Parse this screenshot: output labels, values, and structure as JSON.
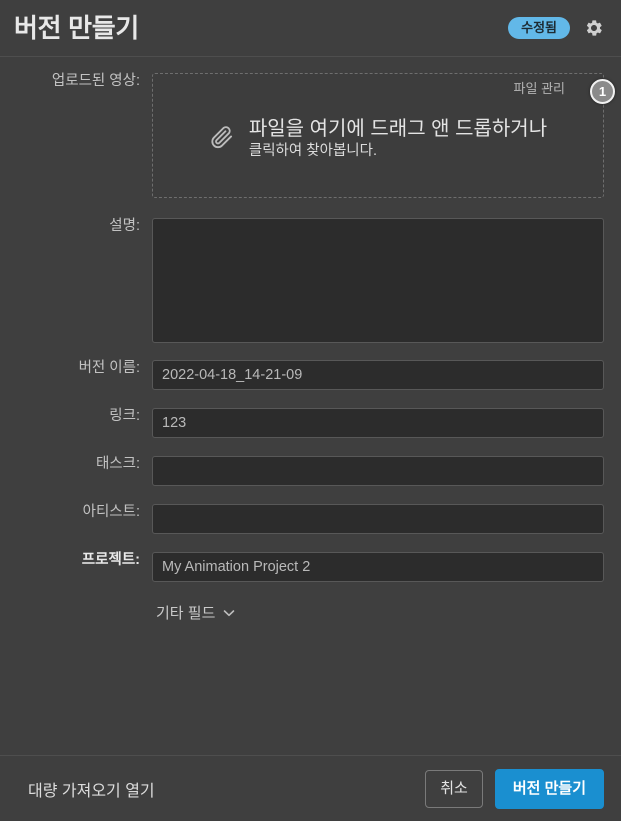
{
  "header": {
    "title": "버전 만들기",
    "status_badge": "수정됨",
    "gear_icon": "gear-icon",
    "badge_color": "#62b8e8"
  },
  "upload": {
    "label": "업로드된 영상:",
    "manage_link": "파일 관리",
    "marker": "1",
    "clip_icon": "paperclip-icon",
    "drop_main": "파일을 여기에 드래그 앤 드롭하거나",
    "drop_sub": "클릭하여 찾아봅니다."
  },
  "fields": {
    "description": {
      "label": "설명:",
      "value": "",
      "placeholder": ""
    },
    "version_name": {
      "label": "버전 이름:",
      "value": "2022-04-18_14-21-09",
      "placeholder": ""
    },
    "link": {
      "label": "링크:",
      "value": "123",
      "placeholder": ""
    },
    "task": {
      "label": "태스크:",
      "value": "",
      "placeholder": ""
    },
    "artist": {
      "label": "아티스트:",
      "value": "",
      "placeholder": ""
    },
    "project": {
      "label": "프로젝트:",
      "value": "My Animation Project 2",
      "placeholder": ""
    }
  },
  "extra_fields": {
    "label": "기타 필드",
    "chevron_icon": "chevron-down-icon"
  },
  "footer": {
    "bulk_import": "대량 가져오기 열기",
    "cancel": "취소",
    "submit": "버전 만들기",
    "primary_color": "#1a8fd0"
  }
}
